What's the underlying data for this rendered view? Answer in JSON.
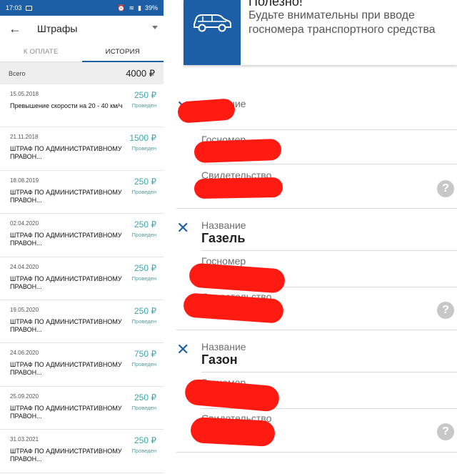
{
  "status_bar": {
    "time": "17:03",
    "battery": "39%"
  },
  "header": {
    "title": "Штрафы"
  },
  "tabs": [
    {
      "label": "К ОПЛАТЕ"
    },
    {
      "label": "ИСТОРИЯ"
    }
  ],
  "total": {
    "label": "Всего",
    "value": "4000 ₽"
  },
  "fines": [
    {
      "date": "15.05.2018",
      "amount": "250 ₽",
      "status": "Проведен",
      "description": "Превышение скорости на 20 - 40 км/ч"
    },
    {
      "date": "21.11.2018",
      "amount": "1500 ₽",
      "status": "Проведен",
      "description": "ШТРАФ ПО АДМИНИСТРАТИВНОМУ ПРАВОН..."
    },
    {
      "date": "18.08.2019",
      "amount": "250 ₽",
      "status": "Проведен",
      "description": "ШТРАФ ПО АДМИНИСТРАТИВНОМУ ПРАВОН..."
    },
    {
      "date": "02.04.2020",
      "amount": "250 ₽",
      "status": "Проведен",
      "description": "ШТРАФ ПО АДМИНИСТРАТИВНОМУ ПРАВОН..."
    },
    {
      "date": "24.04.2020",
      "amount": "250 ₽",
      "status": "Проведен",
      "description": "ШТРАФ ПО АДМИНИСТРАТИВНОМУ ПРАВОН..."
    },
    {
      "date": "19.05.2020",
      "amount": "250 ₽",
      "status": "Проведен",
      "description": "ШТРАФ ПО АДМИНИСТРАТИВНОМУ ПРАВОН..."
    },
    {
      "date": "24.06.2020",
      "amount": "750 ₽",
      "status": "Проведен",
      "description": "ШТРАФ ПО АДМИНИСТРАТИВНОМУ ПРАВОН..."
    },
    {
      "date": "25.09.2020",
      "amount": "250 ₽",
      "status": "Проведен",
      "description": "ШТРАФ ПО АДМИНИСТРАТИВНОМУ ПРАВОН..."
    },
    {
      "date": "31.03.2021",
      "amount": "250 ₽",
      "status": "Проведен",
      "description": "ШТРАФ ПО АДМИНИСТРАТИВНОМУ ПРАВОН..."
    }
  ],
  "info": {
    "title": "Полезно!",
    "text": "Будьте внимательны при вводе госномера транспортного средства"
  },
  "vehicles": [
    {
      "name_label": "Название",
      "name": "",
      "plate_label": "Госномер",
      "cert_label": "Свидетельство"
    },
    {
      "name_label": "Название",
      "name": "Газель",
      "plate_label": "Госномер",
      "cert_label": "Свидетельство"
    },
    {
      "name_label": "Название",
      "name": "Газон",
      "plate_label": "Госномер",
      "cert_label": "Свидетельство"
    }
  ],
  "help_glyph": "?",
  "remove_glyph": "✕",
  "colors": {
    "brand": "#1c5fa7",
    "accent": "#39a7ad",
    "redaction": "#ff1a12"
  }
}
